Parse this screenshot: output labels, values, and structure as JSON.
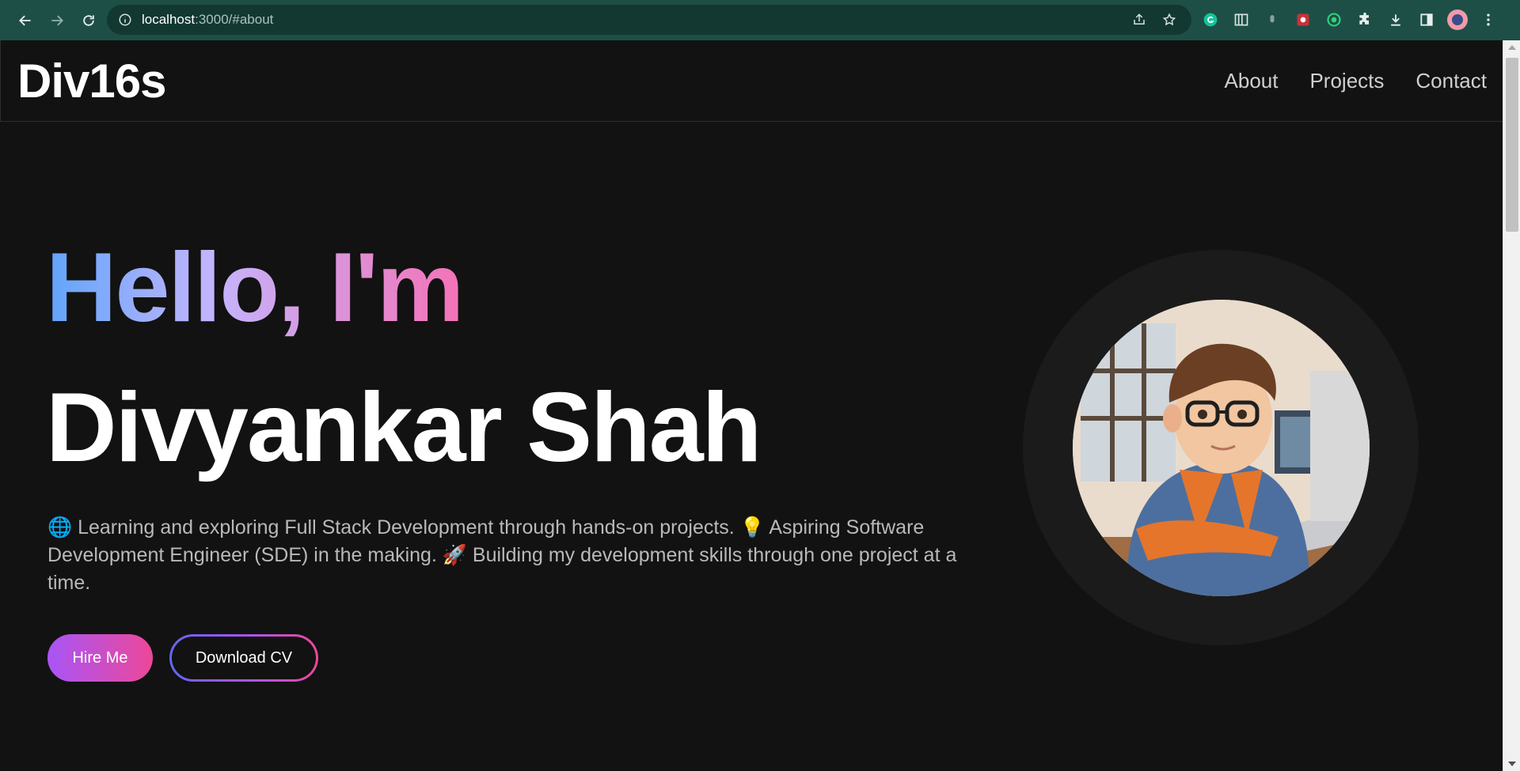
{
  "browser": {
    "url_host": "localhost",
    "url_path": ":3000/#about"
  },
  "site": {
    "logo": "Div16s",
    "nav": [
      {
        "label": "About"
      },
      {
        "label": "Projects"
      },
      {
        "label": "Contact"
      }
    ]
  },
  "hero": {
    "greeting": "Hello, I'm",
    "name": "Divyankar Shah",
    "description": "🌐 Learning and exploring Full Stack Development through hands-on projects. 💡 Aspiring Software Development Engineer (SDE) in the making. 🚀 Building my development skills through one project at a time.",
    "primary_button": "Hire Me",
    "secondary_button": "Download CV"
  },
  "colors": {
    "background": "#121212",
    "gradient_start": "#60a5fa",
    "gradient_mid": "#c4b5fd",
    "gradient_end": "#f472b6",
    "button_gradient": [
      "#a855f7",
      "#ec4899"
    ],
    "browser_frame": "#1d4f47"
  },
  "icons": [
    "back-icon",
    "forward-icon",
    "reload-icon",
    "site-info-icon",
    "share-icon",
    "star-icon",
    "grammarly-icon",
    "extension-icon",
    "puzzle-icon",
    "download-icon",
    "side-panel-icon",
    "profile-avatar",
    "menu-icon"
  ]
}
